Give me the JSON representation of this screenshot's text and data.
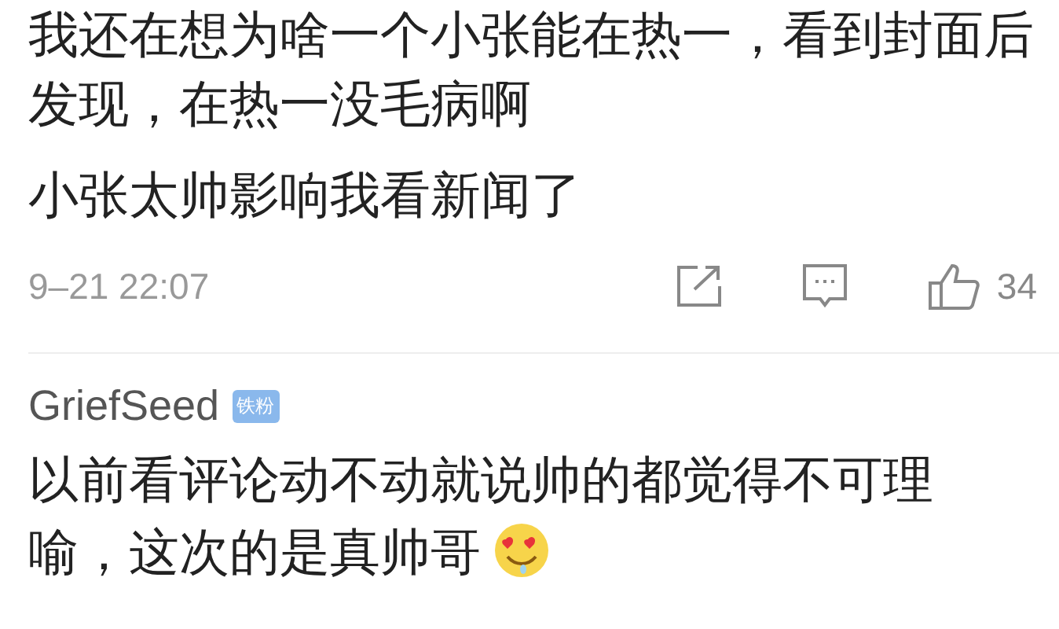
{
  "comment_top": {
    "paragraphs": [
      "我还在想为啥一个小张能在热一，看到封面后发现，在热一没毛病啊",
      "小张太帅影响我看新闻了"
    ],
    "time": "9–21 22:07",
    "likes": "34"
  },
  "comment_next": {
    "username": "GriefSeed",
    "badge": "铁粉",
    "text": "以前看评论动不动就说帅的都觉得不可理喻，这次的是真帅哥"
  }
}
